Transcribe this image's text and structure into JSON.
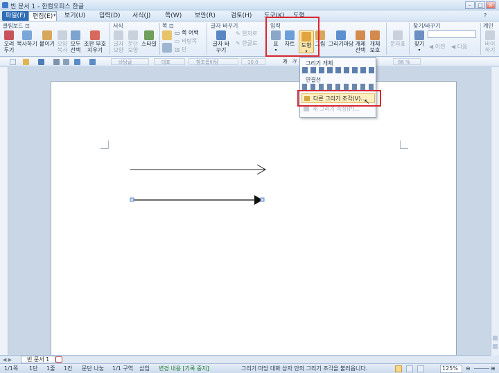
{
  "window": {
    "title": "빈 문서 1 - 한컴오피스 한글",
    "controls": [
      "–",
      "□",
      "×"
    ]
  },
  "menubar": {
    "file": "파일(F)",
    "items": [
      "편집(E)",
      "보기(U)",
      "입력(D)",
      "서식(J)",
      "쪽(W)",
      "보안(R)",
      "검토(H)",
      "도구(K)",
      "도형"
    ]
  },
  "ribbon": {
    "groups": {
      "clipboard": "클립보드 ⊡",
      "format": "서식",
      "page": "쪽 ⊡",
      "replace": "글자 바꾸기",
      "insert": "입력",
      "find": "찾기/바꾸기",
      "tail": "계인"
    },
    "buttons": {
      "cut": "오려 두기",
      "copy": "복사하기",
      "paste": "붙이기",
      "shape_copy": "모양 복사",
      "select_all": "모두 선택",
      "erase": "조판 부호 지우기",
      "char_shape": "글자 모양",
      "para_shape": "문단 모양",
      "style": "스타일",
      "columns": "쪽 여백",
      "col_dim": "바탕쪽",
      "split": "단",
      "replace_char": "글자 바꾸기",
      "hanja": "한자로",
      "hangul": "한글로",
      "table": "표",
      "chart": "차트",
      "shape": "도형",
      "picture": "그림",
      "drawing_wizard": "그리기마당",
      "obj_select": "개체 선택",
      "obj_protect": "개체 보호",
      "charmap": "문자표",
      "find": "찾기",
      "prev": "이전",
      "next": "다음",
      "tail_btn": "바이 하기"
    }
  },
  "toolbar": {
    "style": "바탕글",
    "para": "대표",
    "font": "함초롬바탕",
    "size": "10.0",
    "bold": "가",
    "italic": "가",
    "zoom": "88 %"
  },
  "popup": {
    "drawing_objects": "그리기 개체",
    "connectors": "연결선",
    "other_pieces": "다른 그리기 조각(V)...",
    "save_props": "새 그리기 속성(P)..."
  },
  "document": {
    "tab": "빈 문서 1"
  },
  "statusbar": {
    "page": "1/1쪽",
    "section": "1단",
    "line": "1줄",
    "col": "1칸",
    "mode": "문단 나눔",
    "zone": "1/1 구역",
    "insert": "삽입",
    "track": "변경 내용 [기록 중지]",
    "hint": "그리기 마당 대화 상자 안의 그리기 조각을 불러옵니다.",
    "zoom": "125%"
  },
  "colors": {
    "highlight": "#d9252f",
    "accent": "#2f6db5"
  }
}
